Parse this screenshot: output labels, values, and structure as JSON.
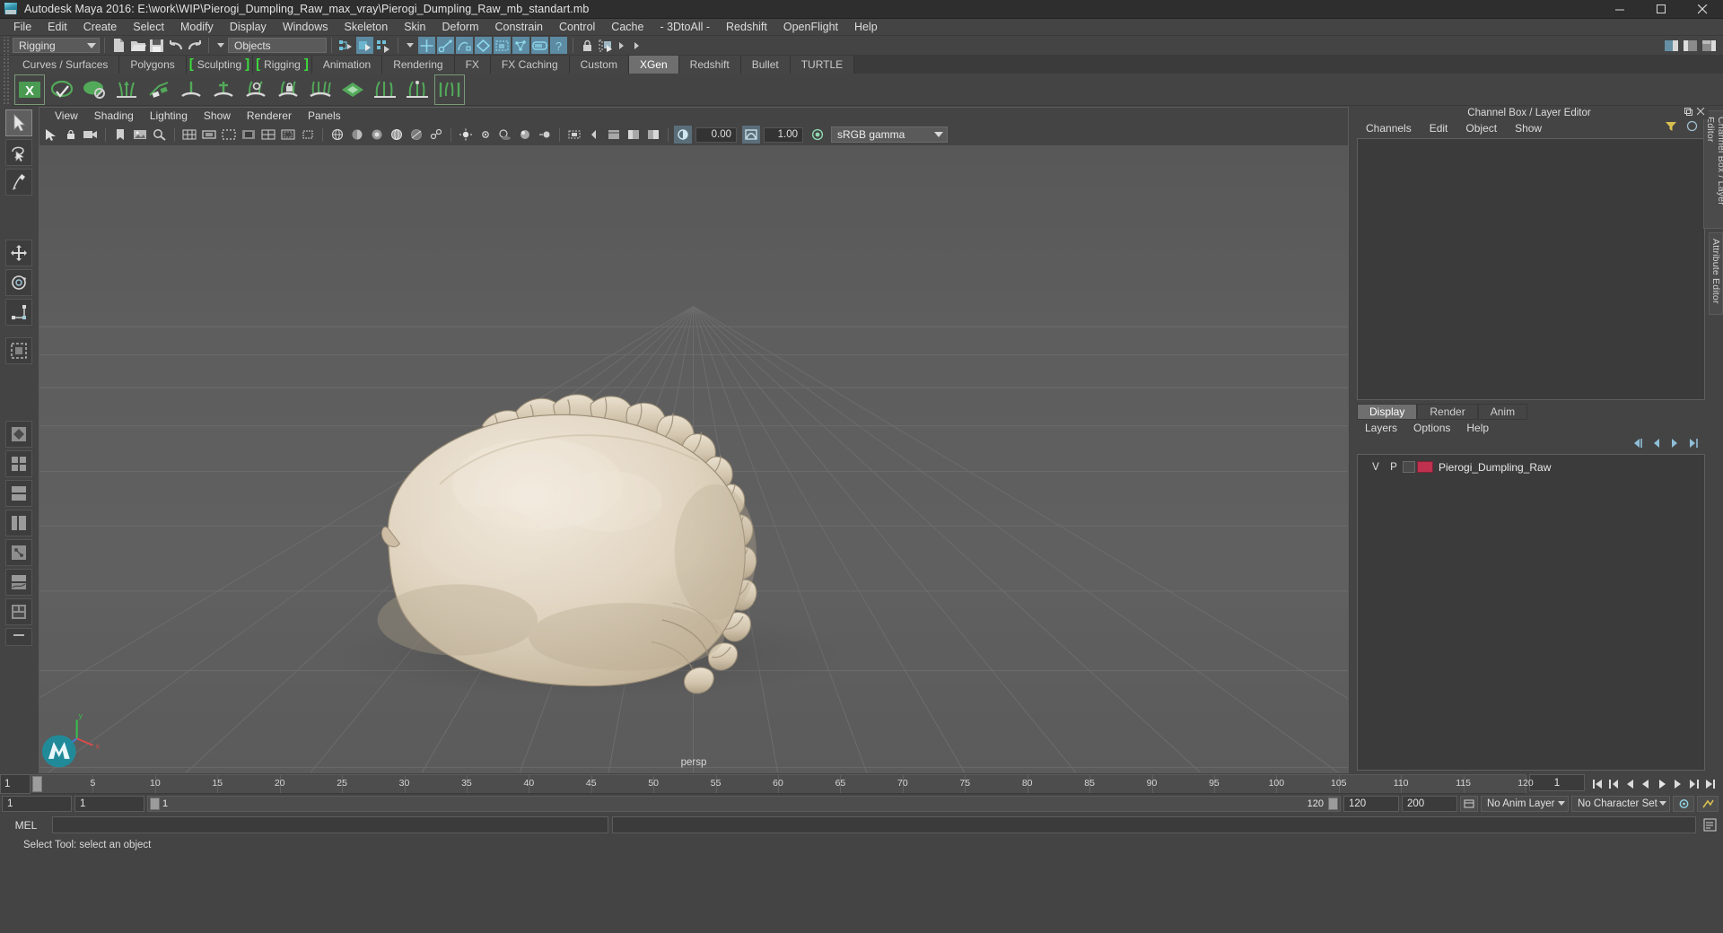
{
  "window": {
    "title": "Autodesk Maya 2016: E:\\work\\WIP\\Pierogi_Dumpling_Raw_max_vray\\Pierogi_Dumpling_Raw_mb_standart.mb",
    "app_icon": "maya-icon",
    "minimize": "minimize-icon",
    "maximize": "maximize-icon",
    "close": "close-icon"
  },
  "menubar": {
    "items": [
      "File",
      "Edit",
      "Create",
      "Select",
      "Modify",
      "Display",
      "Windows",
      "Skeleton",
      "Skin",
      "Deform",
      "Constrain",
      "Control",
      "Cache",
      "- 3DtoAll -",
      "Redshift",
      "OpenFlight",
      "Help"
    ]
  },
  "statusbar": {
    "menu_set": "Rigging",
    "selection_mask": "Objects"
  },
  "shelf": {
    "tabs": [
      {
        "label": "Curves / Surfaces",
        "active": false,
        "bracket": "none"
      },
      {
        "label": "Polygons",
        "active": false,
        "bracket": "none"
      },
      {
        "label": "Sculpting",
        "active": false,
        "bracket": "both"
      },
      {
        "label": "Rigging",
        "active": false,
        "bracket": "both"
      },
      {
        "label": "Animation",
        "active": false,
        "bracket": "none"
      },
      {
        "label": "Rendering",
        "active": false,
        "bracket": "none"
      },
      {
        "label": "FX",
        "active": false,
        "bracket": "none"
      },
      {
        "label": "FX Caching",
        "active": false,
        "bracket": "none"
      },
      {
        "label": "Custom",
        "active": false,
        "bracket": "none"
      },
      {
        "label": "XGen",
        "active": true,
        "bracket": "none"
      },
      {
        "label": "Redshift",
        "active": false,
        "bracket": "none"
      },
      {
        "label": "Bullet",
        "active": false,
        "bracket": "none"
      },
      {
        "label": "TURTLE",
        "active": false,
        "bracket": "none"
      }
    ]
  },
  "viewport": {
    "menus": [
      "View",
      "Shading",
      "Lighting",
      "Show",
      "Renderer",
      "Panels"
    ],
    "exposure": "0.00",
    "gamma": "1.00",
    "color_management": "sRGB gamma",
    "camera_label": "persp",
    "axis_gizmo": "axis-orientation-gizmo"
  },
  "right_panel": {
    "title": "Channel Box / Layer Editor",
    "tabs": [
      "Channels",
      "Edit",
      "Object",
      "Show"
    ],
    "layer_editor": {
      "mode_tabs": [
        "Display",
        "Render",
        "Anim"
      ],
      "active_mode": "Display",
      "menus": [
        "Layers",
        "Options",
        "Help"
      ],
      "columns": [
        "V",
        "P"
      ],
      "layers": [
        {
          "visible": "V",
          "playback": "P",
          "color": "#c0304f",
          "name": "Pierogi_Dumpling_Raw"
        }
      ]
    },
    "side_tabs": [
      "Channel Box / Layer Editor",
      "Attribute Editor"
    ]
  },
  "timeline": {
    "start_display": "1",
    "current_frame": "1",
    "end_field": "120",
    "ticks": [
      5,
      10,
      15,
      20,
      25,
      30,
      35,
      40,
      45,
      50,
      55,
      60,
      65,
      70,
      75,
      80,
      85,
      90,
      95,
      100,
      105,
      110,
      115,
      120
    ],
    "range": {
      "anim_start": "1",
      "range_start": "1",
      "slider_left_value": "1",
      "slider_right_value": "120",
      "range_end": "120",
      "anim_end": "200"
    },
    "anim_layer": "No Anim Layer",
    "character_set": "No Character Set",
    "playback_controls": [
      "go-to-start-icon",
      "step-back-frame-icon",
      "step-back-key-icon",
      "play-backwards-icon",
      "play-forwards-icon",
      "step-forward-key-icon",
      "step-forward-frame-icon",
      "go-to-end-icon"
    ]
  },
  "command_line": {
    "language": "MEL",
    "input_value": "",
    "output_value": ""
  },
  "statusline": {
    "help_text": "Select Tool: select an object"
  },
  "toolbox": {
    "items": [
      "select-tool",
      "lasso-select-tool",
      "paint-select-tool",
      "move-tool",
      "rotate-tool",
      "scale-tool",
      "last-tool",
      "view-layout-single",
      "view-layout-four",
      "view-layout-two-stacked",
      "view-layout-outliner-persp",
      "view-layout-hypergraph",
      "view-layout-persp-graph",
      "view-layout-hypershade",
      "more-layouts"
    ]
  }
}
